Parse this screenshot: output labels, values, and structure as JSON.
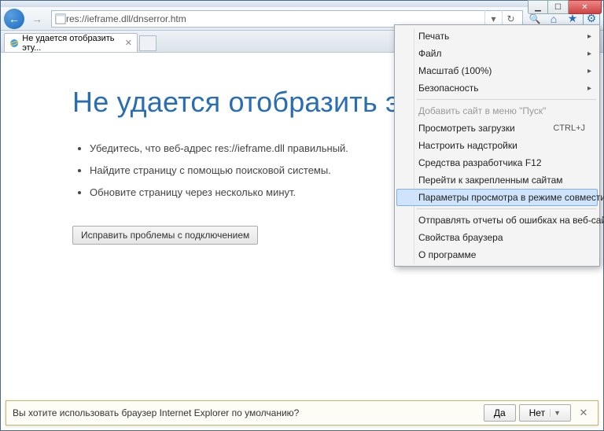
{
  "address_url": "res://ieframe.dll/dnserror.htm",
  "tab": {
    "title": "Не удается отобразить эту..."
  },
  "page": {
    "heading": "Не удается отобразить эту страницу",
    "bullets": [
      "Убедитесь, что веб-адрес res://ieframe.dll правильный.",
      "Найдите страницу с помощью поисковой системы.",
      "Обновите страницу через несколько минут."
    ],
    "fix_button": "Исправить проблемы с подключением"
  },
  "menu": {
    "print": "Печать",
    "file": "Файл",
    "zoom": "Масштаб (100%)",
    "safety": "Безопасность",
    "add_start": "Добавить сайт в меню \"Пуск\"",
    "downloads": "Просмотреть загрузки",
    "downloads_sc": "CTRL+J",
    "addons": "Настроить надстройки",
    "devtools": "Средства разработчика F12",
    "pinned": "Перейти к закрепленным сайтам",
    "compat": "Параметры просмотра в режиме совместимости",
    "report": "Отправлять отчеты об ошибках на веб-сайтах",
    "props": "Свойства браузера",
    "about": "О программе"
  },
  "bottombar": {
    "text": "Вы хотите использовать браузер Internet Explorer по умолчанию?",
    "yes": "Да",
    "no": "Нет"
  }
}
